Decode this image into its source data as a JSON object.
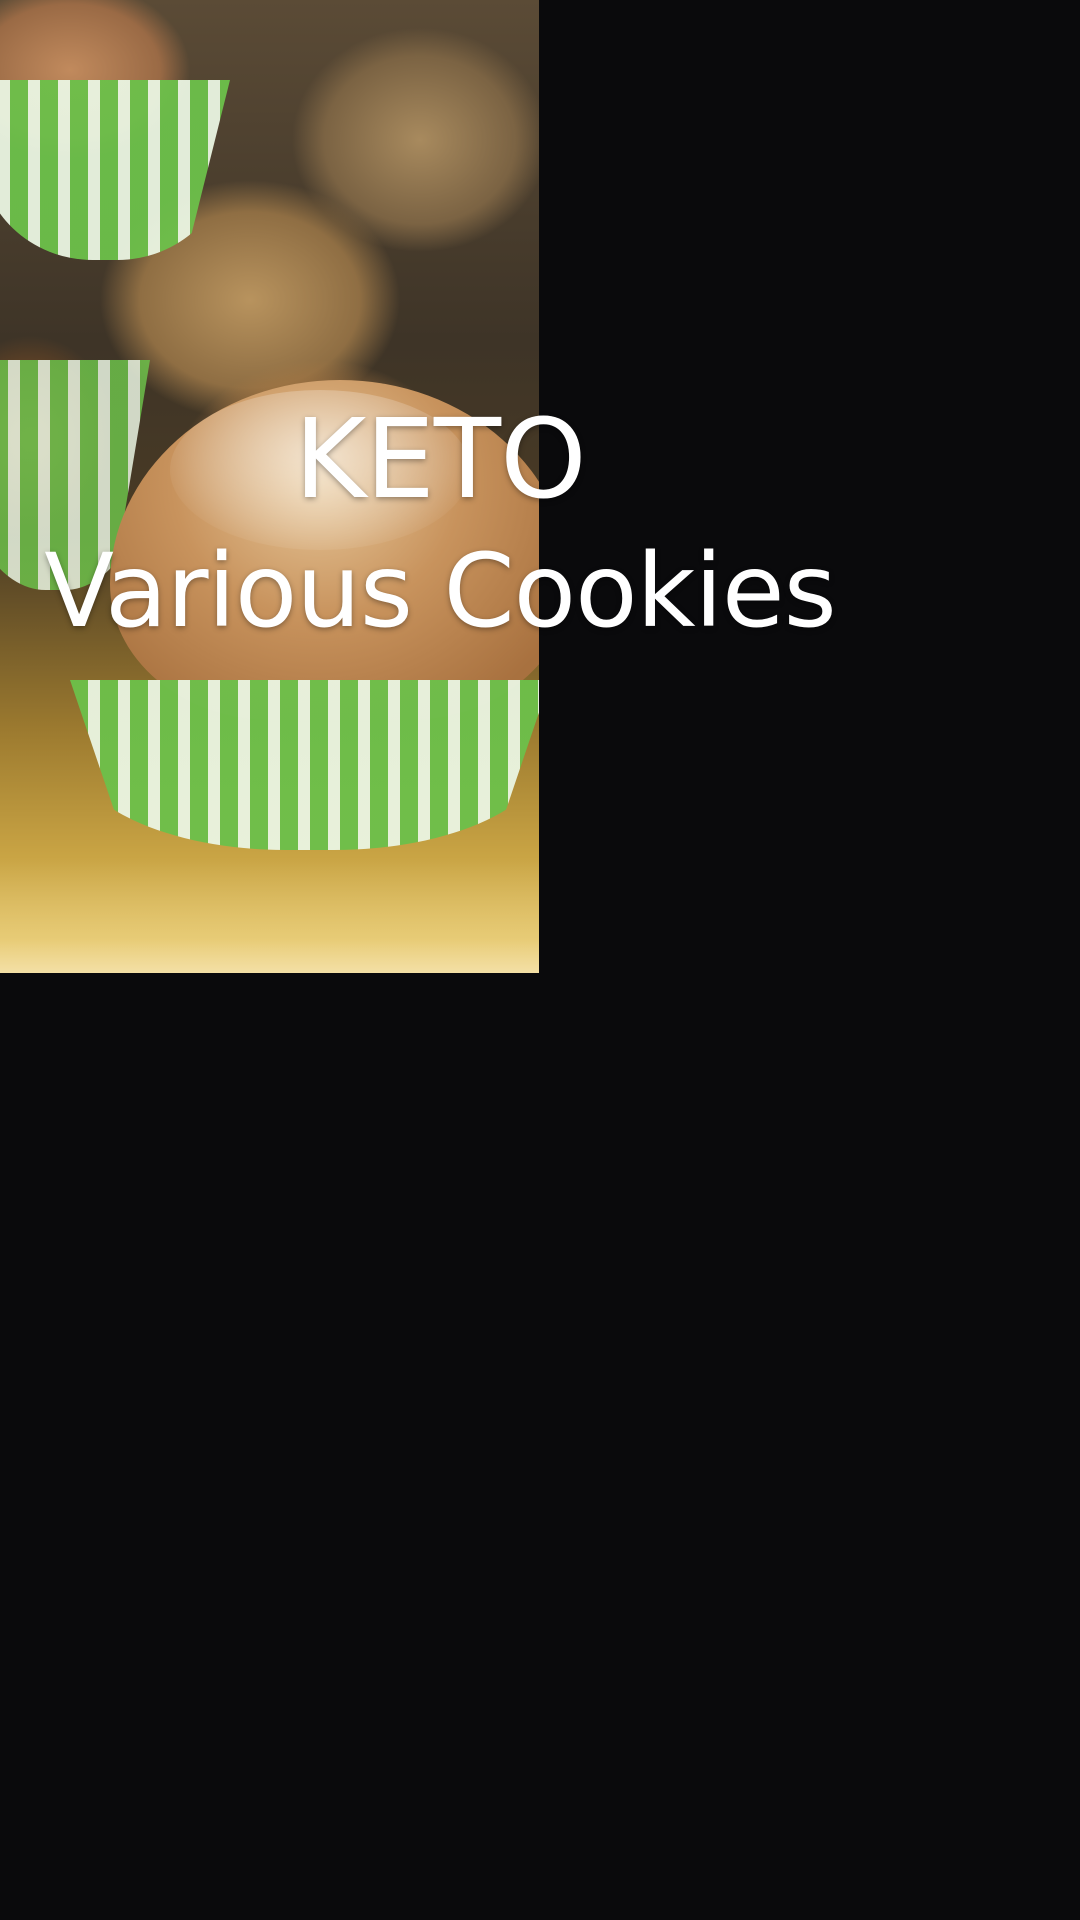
{
  "video": {
    "title_line_1": "KETO",
    "title_line_2": "Various Cookies",
    "background_color": "#0a0a0c",
    "image_subject": "keto cookies in green paper cups on gold tray"
  }
}
